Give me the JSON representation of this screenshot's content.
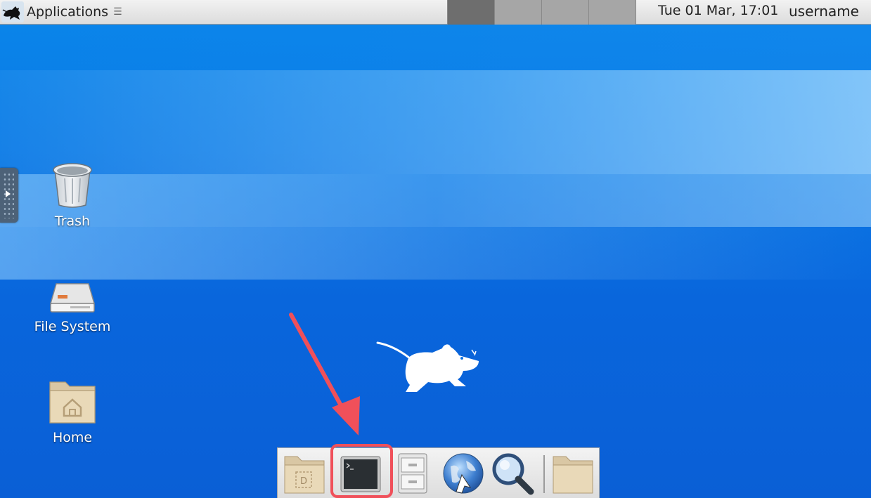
{
  "top_panel": {
    "applications_label": "Applications",
    "menu_glyph": "☰",
    "workspaces": [
      {
        "name": "workspace-1",
        "active": true
      },
      {
        "name": "workspace-2",
        "active": false
      },
      {
        "name": "workspace-3",
        "active": false
      },
      {
        "name": "workspace-4",
        "active": false
      }
    ],
    "clock": "Tue 01 Mar, 17:01",
    "username": "username"
  },
  "desktop": {
    "icons": [
      {
        "label": "Trash",
        "icon": "trash-icon"
      },
      {
        "label": "File System",
        "icon": "drive-icon"
      },
      {
        "label": "Home",
        "icon": "home-folder-icon"
      }
    ],
    "logo": "xfce-mouse-icon"
  },
  "dock": {
    "items": [
      {
        "name": "desktop-folder",
        "icon": "folder-desktop-icon",
        "glyph": "D"
      },
      {
        "name": "terminal",
        "icon": "terminal-icon",
        "highlighted": true
      },
      {
        "name": "file-manager",
        "icon": "file-cabinet-icon"
      },
      {
        "name": "web-browser",
        "icon": "globe-icon"
      },
      {
        "name": "app-finder",
        "icon": "magnifier-icon"
      },
      {
        "name": "folder",
        "icon": "folder-icon"
      }
    ]
  },
  "annotation": {
    "color": "#f0505a",
    "type": "arrow-and-box"
  },
  "colors": {
    "desktop_blue": "#0a6fe0",
    "panel_grey": "#e4e4e4",
    "highlight_red": "#f0505a"
  }
}
